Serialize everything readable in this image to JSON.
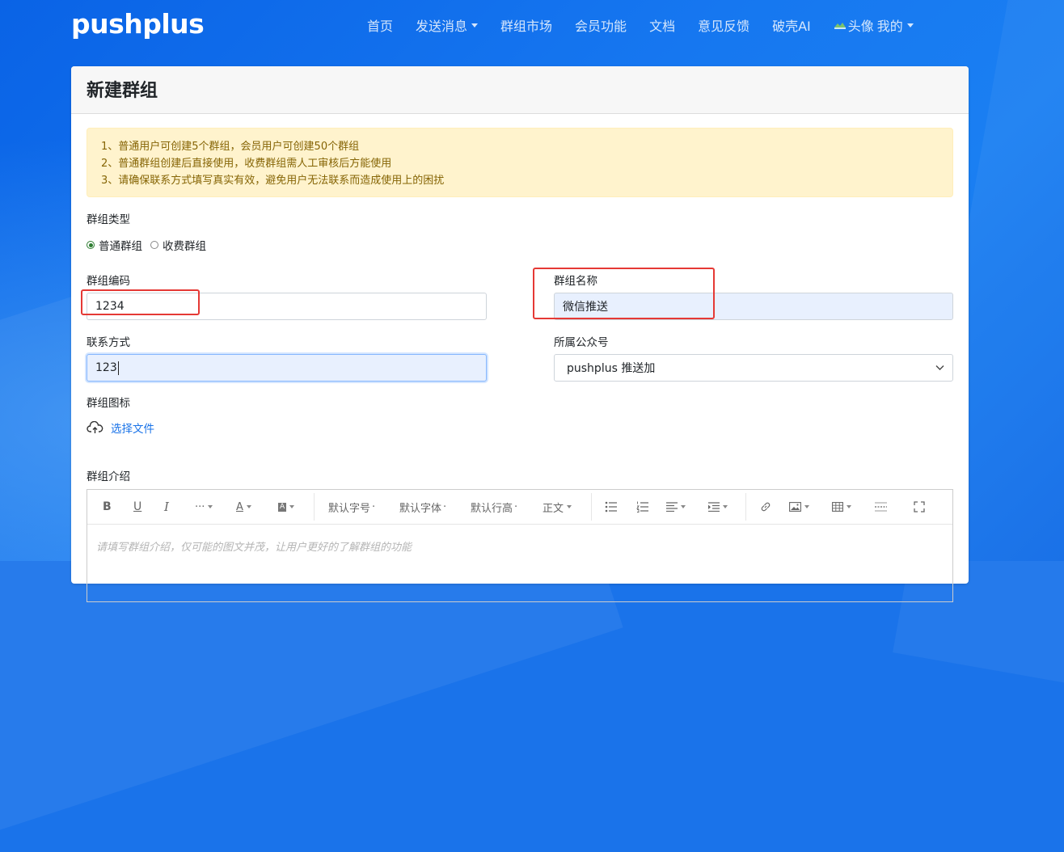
{
  "brand": "pushplus",
  "nav": {
    "home": "首页",
    "send": "发送消息",
    "market": "群组市场",
    "member": "会员功能",
    "docs": "文档",
    "feedback": "意见反馈",
    "ai": "破壳AI",
    "avatar_alt": "头像",
    "mine": "我的"
  },
  "page": {
    "title": "新建群组",
    "notice": [
      "1、普通用户可创建5个群组，会员用户可创建50个群组",
      "2、普通群组创建后直接使用，收费群组需人工审核后方能使用",
      "3、请确保联系方式填写真实有效，避免用户无法联系而造成使用上的困扰"
    ]
  },
  "form": {
    "type_label": "群组类型",
    "type_options": [
      "普通群组",
      "收费群组"
    ],
    "type_selected": "普通群组",
    "code_label": "群组编码",
    "code_value": "1234",
    "name_label": "群组名称",
    "name_value": "微信推送",
    "contact_label": "联系方式",
    "contact_value": "123",
    "account_label": "所属公众号",
    "account_value": "pushplus 推送加",
    "icon_label": "群组图标",
    "upload_label": "选择文件",
    "intro_label": "群组介绍",
    "intro_placeholder": "请填写群组介绍，仅可能的图文并茂，让用户更好的了解群组的功能"
  },
  "toolbar": {
    "bold": "B",
    "underline": "U",
    "italic": "I",
    "more": "···",
    "font_color": "A",
    "bg_color": "A",
    "font_size": "默认字号",
    "font_family": "默认字体",
    "line_height": "默认行高",
    "heading": "正文"
  },
  "colors": {
    "brand_blue": "#1677f0",
    "notice_bg": "#fff3cd",
    "notice_text": "#856404",
    "highlight_red": "#e53935",
    "link_blue": "#1a73e8",
    "radio_green": "#2e7d32"
  },
  "icons": [
    "caret-down-icon",
    "broken-image-icon",
    "cloud-upload-icon",
    "chevron-down-icon",
    "bold-icon",
    "underline-icon",
    "italic-icon",
    "more-icon",
    "font-color-icon",
    "bg-color-icon",
    "bullet-list-icon",
    "numbered-list-icon",
    "align-icon",
    "indent-icon",
    "link-icon",
    "image-icon",
    "table-icon",
    "divider-icon",
    "fullscreen-icon"
  ]
}
